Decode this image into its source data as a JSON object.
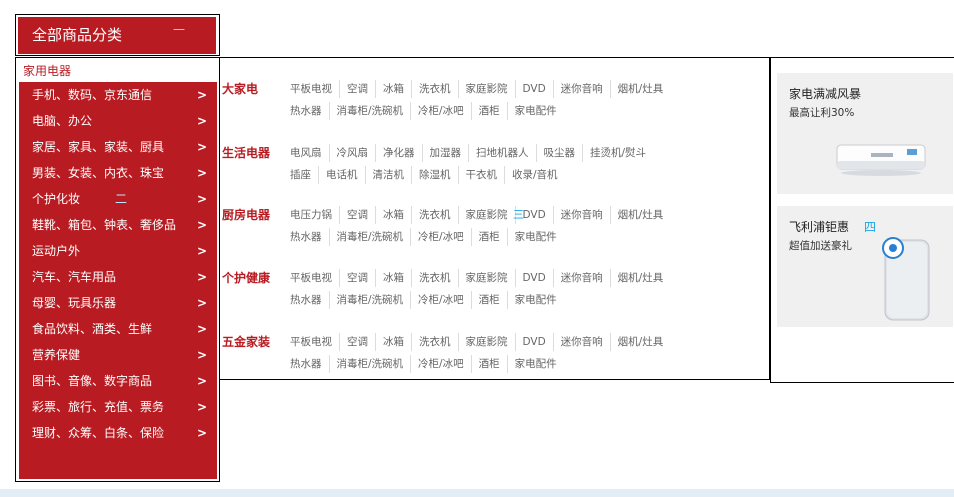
{
  "header": {
    "title": "全部商品分类",
    "dash": "—"
  },
  "sidebar": {
    "items": [
      {
        "label": "家用电器",
        "arrow": ""
      },
      {
        "label": "手机、数码、京东通信",
        "arrow": ">"
      },
      {
        "label": "电脑、办公",
        "arrow": ">"
      },
      {
        "label": "家居、家具、家装、厨具",
        "arrow": ">"
      },
      {
        "label": "男装、女装、内衣、珠宝",
        "arrow": ">"
      },
      {
        "label": "个护化妆",
        "arrow": ">",
        "deco": "二"
      },
      {
        "label": "鞋靴、箱包、钟表、奢侈品",
        "arrow": ">"
      },
      {
        "label": "运动户外",
        "arrow": ">"
      },
      {
        "label": "汽车、汽车用品",
        "arrow": ">"
      },
      {
        "label": "母婴、玩具乐器",
        "arrow": ">"
      },
      {
        "label": "食品饮料、酒类、生鲜",
        "arrow": ">"
      },
      {
        "label": "营养保健",
        "arrow": ">"
      },
      {
        "label": "图书、音像、数字商品",
        "arrow": ">"
      },
      {
        "label": "彩票、旅行、充值、票务",
        "arrow": ">"
      },
      {
        "label": "理财、众筹、白条、保险",
        "arrow": ">"
      }
    ]
  },
  "sections": [
    {
      "title": "大家电",
      "line1": [
        "平板电视",
        "空调",
        "冰箱",
        "洗衣机",
        "家庭影院",
        "DVD",
        "迷你音响",
        "烟机/灶具"
      ],
      "line2": [
        "热水器",
        "消毒柜/洗碗机",
        "冷柜/冰吧",
        "酒柜",
        "家电配件"
      ]
    },
    {
      "title": "生活电器",
      "line1": [
        "电风扇",
        "冷风扇",
        "净化器",
        "加湿器",
        "扫地机器人",
        "吸尘器",
        "挂烫机/熨斗"
      ],
      "line2": [
        "插座",
        "电话机",
        "清洁机",
        "除湿机",
        "干衣机",
        "收录/音机"
      ]
    },
    {
      "title": "厨房电器",
      "overlay": "三",
      "line1": [
        "电压力锅",
        "空调",
        "冰箱",
        "洗衣机",
        "家庭影院",
        "DVD",
        "迷你音响",
        "烟机/灶具"
      ],
      "line2": [
        "热水器",
        "消毒柜/洗碗机",
        "冷柜/冰吧",
        "酒柜",
        "家电配件"
      ]
    },
    {
      "title": "个护健康",
      "line1": [
        "平板电视",
        "空调",
        "冰箱",
        "洗衣机",
        "家庭影院",
        "DVD",
        "迷你音响",
        "烟机/灶具"
      ],
      "line2": [
        "热水器",
        "消毒柜/洗碗机",
        "冷柜/冰吧",
        "酒柜",
        "家电配件"
      ]
    },
    {
      "title": "五金家装",
      "line1": [
        "平板电视",
        "空调",
        "冰箱",
        "洗衣机",
        "家庭影院",
        "DVD",
        "迷你音响",
        "烟机/灶具"
      ],
      "line2": [
        "热水器",
        "消毒柜/洗碗机",
        "冷柜/冰吧",
        "酒柜",
        "家电配件"
      ]
    }
  ],
  "promos": [
    {
      "title": "家电满减风暴",
      "subtitle": "最高让利30%",
      "image": "air-conditioner"
    },
    {
      "title": "飞利浦钜惠",
      "subtitle": "超值加送豪礼",
      "overlay": "四",
      "image": "air-purifier"
    }
  ],
  "colors": {
    "brand_red": "#b81c22",
    "accent_blue": "#19a6e6",
    "promo_bg": "#f0f0f0"
  }
}
